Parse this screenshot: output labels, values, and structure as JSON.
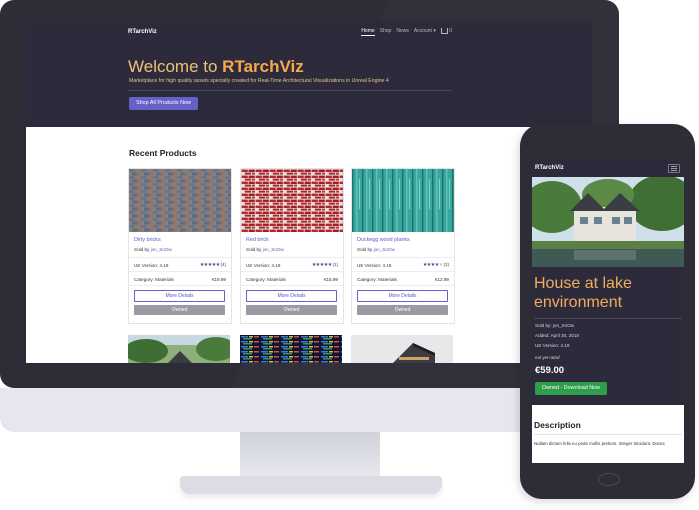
{
  "desktop": {
    "brand": "RTarchViz",
    "nav": [
      {
        "label": "Home",
        "active": true
      },
      {
        "label": "Shop",
        "active": false
      },
      {
        "label": "News",
        "active": false
      },
      {
        "label": "Account ▾",
        "active": false
      }
    ],
    "cart_count": "0",
    "hero": {
      "title_prefix": "Welcome to ",
      "title_brand": "RTarchViz",
      "subtitle": "Marketplace for high quality assets specially created for Real-Time Architectural Visualizations in Unreal Engine 4",
      "button": "Shop All Products Now"
    },
    "recent_title": "Recent Products",
    "sold_by_prefix": "Sold by ",
    "products": [
      {
        "name": "Dirty bricks",
        "seller": "jon_SnOw",
        "ue": "UE Version: 4.18",
        "rating": 5,
        "rating_count": "(4)",
        "category": "Category: Materials",
        "price": "€19.99",
        "more": "More Details",
        "owned": "Owned"
      },
      {
        "name": "Red brick",
        "seller": "jon_SnOw",
        "ue": "UE Version: 4.18",
        "rating": 5,
        "rating_count": "(1)",
        "category": "Category: Materials",
        "price": "€15.99",
        "more": "More Details",
        "owned": "Owned"
      },
      {
        "name": "Duckegg wood planks",
        "seller": "jon_SnOw",
        "ue": "UE Version: 4.18",
        "rating": 3.5,
        "rating_count": "(2)",
        "category": "Category: Materials",
        "price": "€12.99",
        "more": "More Details",
        "owned": "Owned"
      }
    ]
  },
  "phone": {
    "brand": "RTarchViz",
    "title": "House at lake environment",
    "sold_by": "Sold by: jon_SnOw",
    "added": "Added: April 30, 2018",
    "ue": "UE Version: 4.19",
    "not_rated": "not yet rated",
    "price": "€59.00",
    "button": "Owned - Download Now",
    "desc_title": "Description",
    "desc_text": "Nullam dictum felis eu pede mollis pretium. Integer tincidunt. Donec"
  },
  "colors": {
    "accent": "#6760c8",
    "hero_title": "#f6a94a",
    "success": "#2e9e4b",
    "dark_bg": "#2d2b3b",
    "owned_gray": "#9a9aa4"
  }
}
